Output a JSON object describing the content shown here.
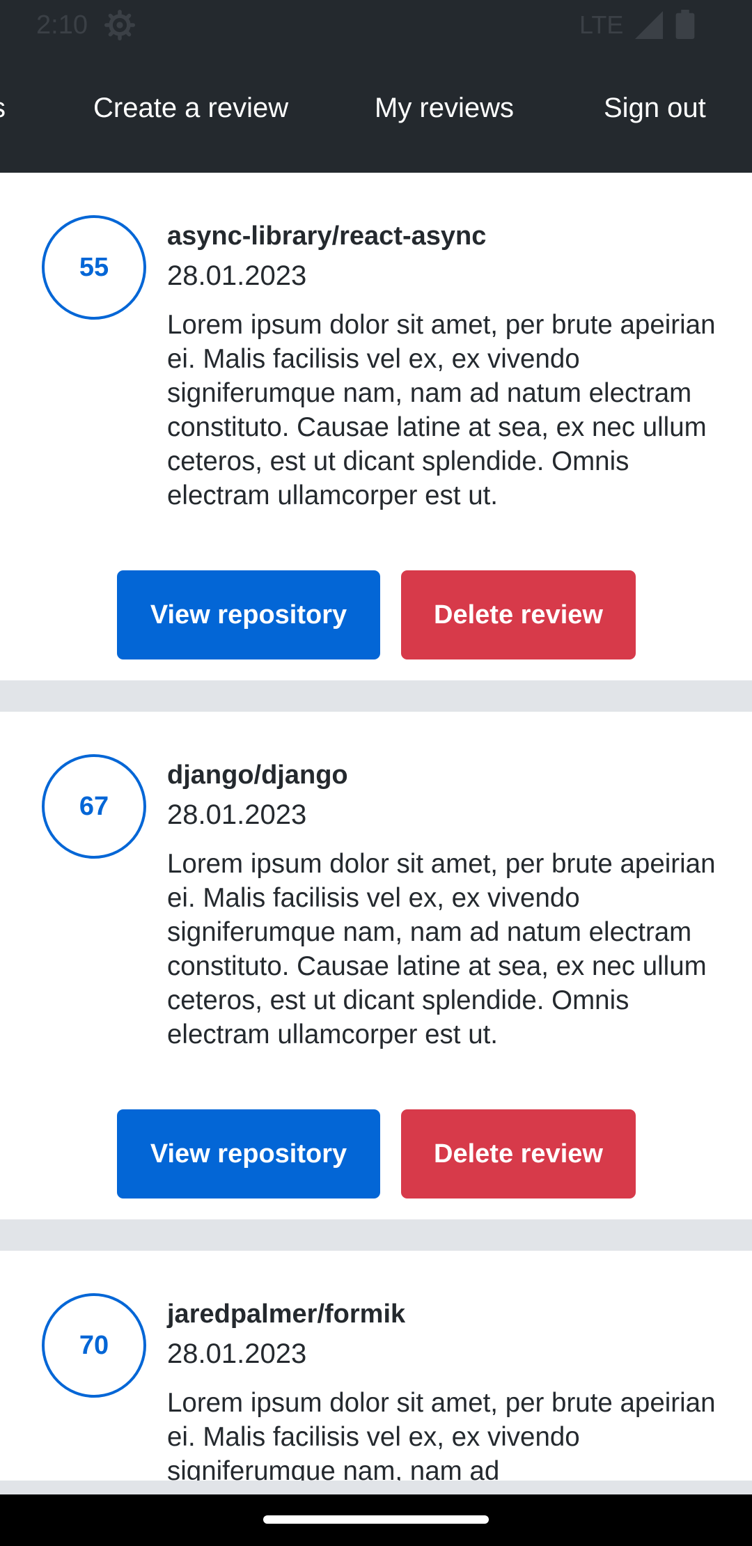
{
  "status_bar": {
    "time": "2:10",
    "network": "LTE",
    "icons": [
      "settings-gear-icon",
      "signal-icon",
      "battery-icon"
    ]
  },
  "nav": {
    "tabs": [
      {
        "label": "s",
        "partial": true
      },
      {
        "label": "Create a review"
      },
      {
        "label": "My reviews"
      },
      {
        "label": "Sign out"
      }
    ]
  },
  "reviews": [
    {
      "rating": "55",
      "repository": "async-library/react-async",
      "date": "28.01.2023",
      "text": "Lorem ipsum dolor sit amet, per brute apeirian ei. Malis facilisis vel ex, ex vivendo signiferumque nam, nam ad natum electram constituto. Causae latine at sea, ex nec ullum ceteros, est ut dicant splendide. Omnis electram ullamcorper est ut.",
      "view_label": "View repository",
      "delete_label": "Delete review"
    },
    {
      "rating": "67",
      "repository": "django/django",
      "date": "28.01.2023",
      "text": "Lorem ipsum dolor sit amet, per brute apeirian ei. Malis facilisis vel ex, ex vivendo signiferumque nam, nam ad natum electram constituto. Causae latine at sea, ex nec ullum ceteros, est ut dicant splendide. Omnis electram ullamcorper est ut.",
      "view_label": "View repository",
      "delete_label": "Delete review"
    },
    {
      "rating": "70",
      "repository": "jaredpalmer/formik",
      "date": "28.01.2023",
      "text": "Lorem ipsum dolor sit amet, per brute apeirian ei. Malis facilisis vel ex, ex vivendo signiferumque nam, nam ad"
    }
  ],
  "colors": {
    "header": "#24292e",
    "primary": "#0366d6",
    "danger": "#d73a4a",
    "separator": "#e1e4e8"
  }
}
